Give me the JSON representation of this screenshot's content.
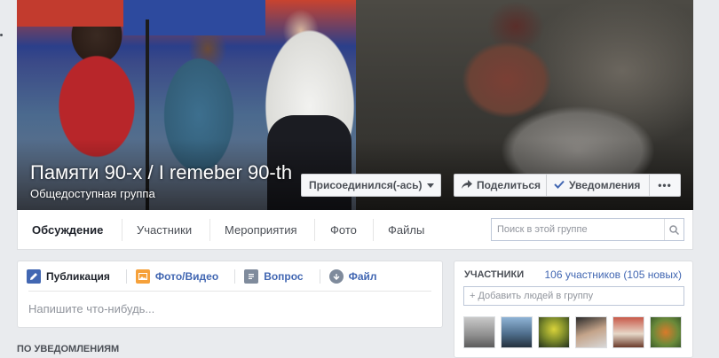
{
  "cover": {
    "title": "Памяти 90-х / I remeber 90-th",
    "subtitle": "Общедоступная группа",
    "join_label": "Присоединился(-ась)",
    "share_label": "Поделиться",
    "notifications_label": "Уведомления",
    "more_label": "•••",
    "icons": {
      "share": "share-arrow-icon",
      "notifications": "check-icon",
      "join": "chevron-down-icon"
    }
  },
  "tabs": [
    {
      "label": "Обсуждение",
      "active": true
    },
    {
      "label": "Участники",
      "active": false
    },
    {
      "label": "Мероприятия",
      "active": false
    },
    {
      "label": "Фото",
      "active": false
    },
    {
      "label": "Файлы",
      "active": false
    }
  ],
  "search": {
    "placeholder": "Поиск в этой группе",
    "icon": "search-icon"
  },
  "composer": {
    "tabs": [
      {
        "label": "Публикация",
        "icon": "pencil-icon",
        "active": true
      },
      {
        "label": "Фото/Видео",
        "icon": "photo-icon",
        "active": false
      },
      {
        "label": "Вопрос",
        "icon": "question-icon",
        "active": false
      },
      {
        "label": "Файл",
        "icon": "file-icon",
        "active": false
      }
    ],
    "placeholder": "Напишите что-нибудь..."
  },
  "feed": {
    "section_label": "ПО УВЕДОМЛЕНИЯМ"
  },
  "members": {
    "title": "УЧАСТНИКИ",
    "count": "106 участников (105 новых)",
    "add_placeholder": "+ Добавить людей в группу"
  },
  "colors": {
    "accent": "#4267b2",
    "background": "#e9ebee"
  }
}
